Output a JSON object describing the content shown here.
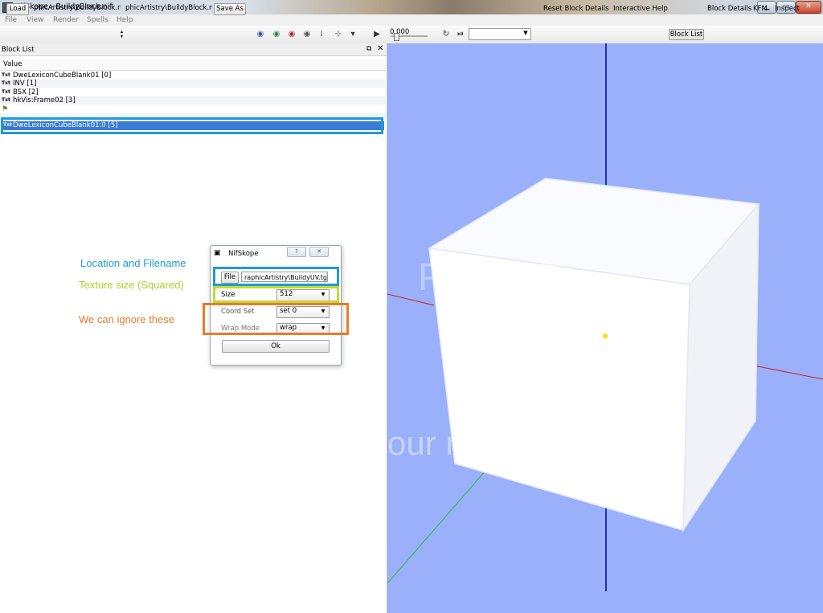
{
  "window": {
    "title": "NifSkope - BuildyBlock.nif",
    "min_label": "▁",
    "max_label": "▭",
    "close_label": "✕"
  },
  "menu": [
    "File",
    "View",
    "Render",
    "Spells",
    "Help"
  ],
  "toolbar": {
    "load_label": "Load",
    "load_path": "phicArtistry\\BuildyBlock.nif",
    "save_path": "phicArtistry\\BuildyBlock.nif",
    "save_as_label": "Save As",
    "time_value": "0.000",
    "play_icon": "play-icon",
    "links": [
      "Reset Block Details",
      "Interactive Help",
      "Block List",
      "Block Details",
      "KFM",
      "Inspect"
    ],
    "active_link": "Block List"
  },
  "block_list": {
    "title": "Block List",
    "column_header": "Value",
    "rows": [
      {
        "icon": "Txt",
        "label": "DweLexiconCubeBlank01 [0]"
      },
      {
        "icon": "Txt",
        "label": "INV [1]"
      },
      {
        "icon": "Txt",
        "label": "BSX [2]"
      },
      {
        "icon": "Txt",
        "label": "hkVis:Frame02 [3]"
      },
      {
        "icon": "node-icon",
        "label": ""
      }
    ],
    "selected_row": {
      "icon": "Txt",
      "label": "DweLexiconCubeBlank01:0 [5]"
    }
  },
  "annotations": {
    "location": "Location and Filename",
    "texture_size": "Texture size (Squared)",
    "ignore": "We can ignore these",
    "colors": {
      "location": "#1e9bd7",
      "texture_size": "#b5cc2e",
      "ignore": "#ea7a2a"
    }
  },
  "dialog": {
    "title": "NifSkope",
    "help_btn": "?",
    "close_btn": "✕",
    "file_button": "File",
    "file_path": "raphicArtistry\\BuildyUV.tga",
    "size_label": "Size",
    "size_value": "512",
    "coord_set_label": "Coord Set",
    "coord_set_value": "set 0",
    "wrap_mode_label": "Wrap Mode",
    "wrap_mode_value": "wrap",
    "ok_label": "Ok"
  },
  "viewport": {
    "watermark_top": "PHOTO",
    "watermark_bottom": "our m             less!"
  }
}
